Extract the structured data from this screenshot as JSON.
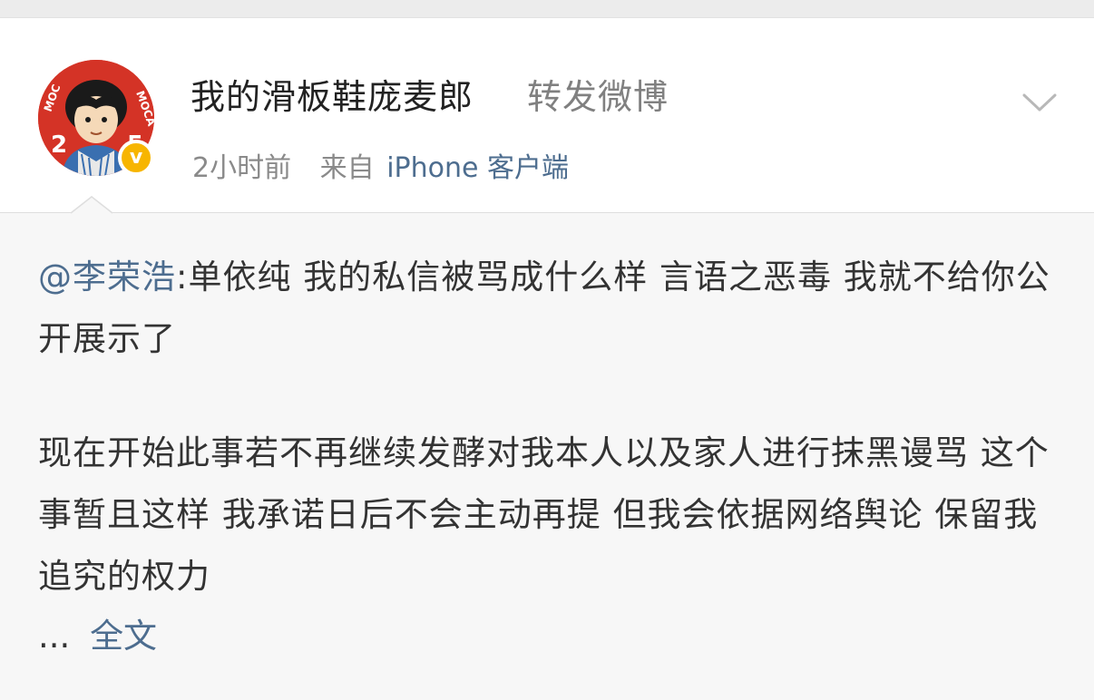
{
  "post": {
    "username": "我的滑板鞋庞麦郎",
    "action": "转发微博",
    "time": "2小时前",
    "from_label": "来自",
    "client": "iPhone 客户端",
    "verified_badge": "v",
    "avatar_icon": "user-avatar",
    "menu_icon": "chevron-down-icon"
  },
  "retweet": {
    "mention": "@李荣浩",
    "text_line1": ":单依纯 我的私信被骂成什么样 言语之恶毒 我就不给你公开展示了",
    "text_para2": "现在开始此事若不再继续发酵对我本人以及家人进行抹黑谩骂 这个事暂且这样 我承诺日后不会主动再提 但我会依据网络舆论 保留我追究的权力",
    "ellipsis": "...",
    "full_text_link": "全文"
  },
  "colors": {
    "link": "#4d6d8f",
    "text": "#333333",
    "muted": "#8a8a8a",
    "badge": "#f7b500",
    "avatar_bg": "#d43326"
  }
}
